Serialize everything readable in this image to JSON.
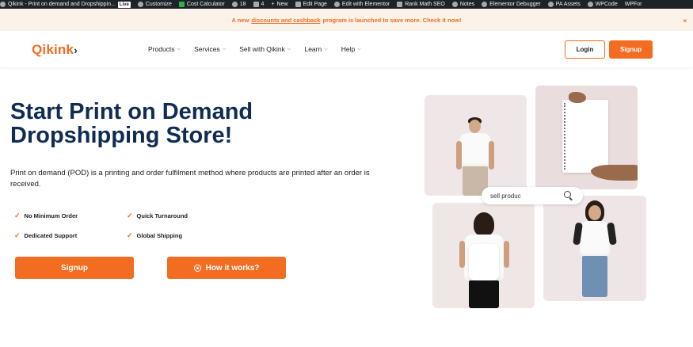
{
  "adminbar": {
    "site": "Qikink - Print on demand and Dropshippin...",
    "live": "Live",
    "items": [
      "Customize",
      "Cost Calculator",
      "18",
      "4",
      "New",
      "Edit Page",
      "Edit with Elementor",
      "Rank Math SEO",
      "Notes",
      "Elementor Debugger",
      "PA Assets",
      "WPCode",
      "WPFor"
    ]
  },
  "announcement": {
    "prefix": "A new",
    "link": "discounts and cashback",
    "suffix": "program is launched to save more. Check it now!",
    "close": "×"
  },
  "header": {
    "logo": "Qikink",
    "logo_mark": "›",
    "nav": [
      "Products",
      "Services",
      "Sell with Qikink",
      "Learn",
      "Help"
    ],
    "login": "Login",
    "signup": "Signup"
  },
  "hero": {
    "title": "Start Print on Demand Dropshipping Store!",
    "description": "Print on demand (POD) is a printing and order fulfilment method where products are printed after an order is received.",
    "features": [
      "No Minimum Order",
      "Quick Turnaround",
      "Dedicated Support",
      "Global Shipping"
    ],
    "signup_button": "Signup",
    "how_button": "How it works?"
  },
  "collage": {
    "search_text": "sell produc"
  },
  "colors": {
    "brand_orange": "#f26d21",
    "navy": "#0f2d52",
    "adminbar_bg": "#1d2327"
  }
}
